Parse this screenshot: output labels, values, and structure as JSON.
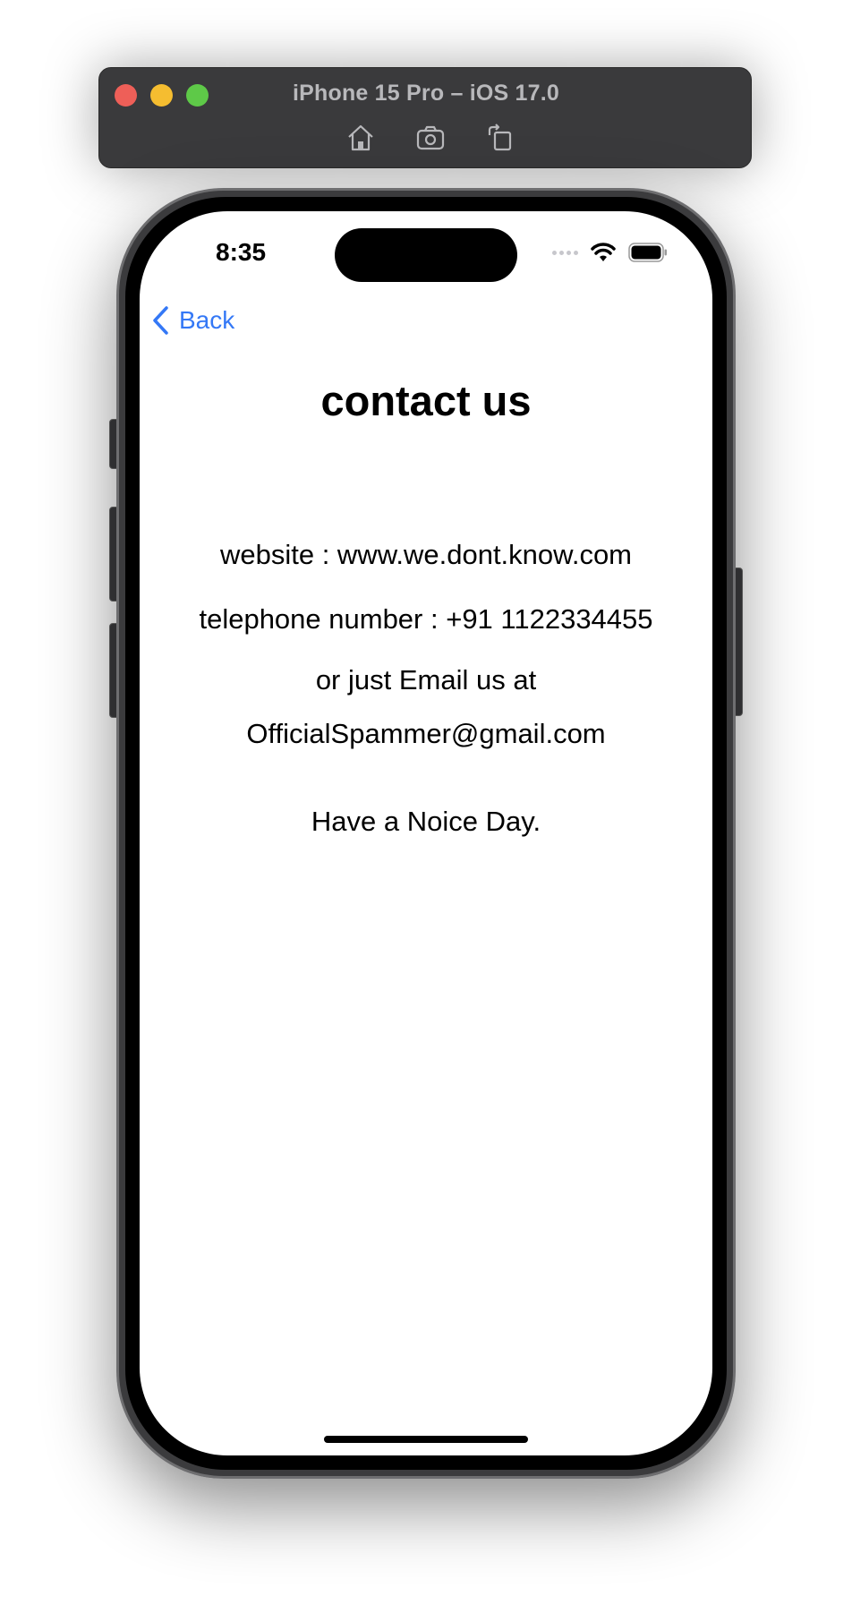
{
  "simulator": {
    "title": "iPhone 15 Pro – iOS 17.0",
    "toolbar": {
      "home_icon": "home-icon",
      "screenshot_icon": "camera-icon",
      "rotate_icon": "rotate-icon"
    }
  },
  "status_bar": {
    "time": "8:35"
  },
  "nav": {
    "back_label": "Back"
  },
  "content": {
    "title": "contact us",
    "website": "website : www.we.dont.know.com",
    "telephone": "telephone number : +91 1122334455",
    "email_prompt": "or just Email us at",
    "email": "OfficialSpammer@gmail.com",
    "farewell": "Have a Noice Day."
  },
  "colors": {
    "accent": "#3478f6",
    "window_chrome": "#3a3a3c",
    "traffic_red": "#ee5f58",
    "traffic_yellow": "#f5bd30",
    "traffic_green": "#5ec948"
  }
}
